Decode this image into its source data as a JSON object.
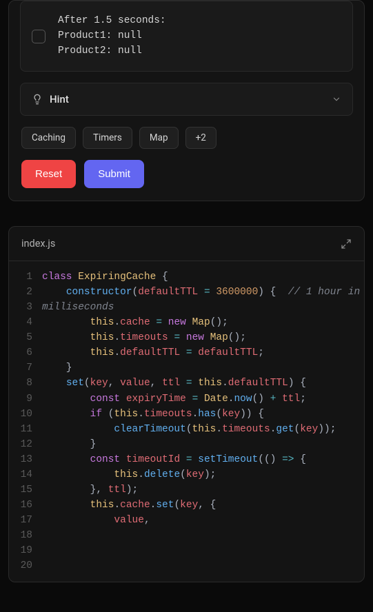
{
  "output": {
    "line1": "After 1.5 seconds:",
    "line2": "Product1: null",
    "line3": "Product2: null"
  },
  "hint": {
    "label": "Hint"
  },
  "tags": [
    "Caching",
    "Timers",
    "Map",
    "+2"
  ],
  "buttons": {
    "reset": "Reset",
    "submit": "Submit"
  },
  "editor": {
    "filename": "index.js"
  },
  "code": {
    "lines": [
      {
        "n": "1",
        "tokens": [
          [
            "kw",
            "class "
          ],
          [
            "cls",
            "ExpiringCache"
          ],
          [
            "pn",
            " {"
          ]
        ]
      },
      {
        "n": "2",
        "tokens": [
          [
            "pn",
            "    "
          ],
          [
            "fn",
            "constructor"
          ],
          [
            "pn",
            "("
          ],
          [
            "param",
            "defaultTTL"
          ],
          [
            "pn",
            " "
          ],
          [
            "op",
            "="
          ],
          [
            "pn",
            " "
          ],
          [
            "num",
            "3600000"
          ],
          [
            "pn",
            ") {  "
          ],
          [
            "cmt",
            "// 1 hour in milliseconds"
          ]
        ]
      },
      {
        "n": "3",
        "tokens": [
          [
            "pn",
            "        "
          ],
          [
            "this",
            "this"
          ],
          [
            "pn",
            "."
          ],
          [
            "prop",
            "cache"
          ],
          [
            "pn",
            " "
          ],
          [
            "op",
            "="
          ],
          [
            "pn",
            " "
          ],
          [
            "new",
            "new "
          ],
          [
            "cls",
            "Map"
          ],
          [
            "pn",
            "();"
          ]
        ]
      },
      {
        "n": "4",
        "tokens": [
          [
            "pn",
            "        "
          ],
          [
            "this",
            "this"
          ],
          [
            "pn",
            "."
          ],
          [
            "prop",
            "timeouts"
          ],
          [
            "pn",
            " "
          ],
          [
            "op",
            "="
          ],
          [
            "pn",
            " "
          ],
          [
            "new",
            "new "
          ],
          [
            "cls",
            "Map"
          ],
          [
            "pn",
            "();"
          ]
        ]
      },
      {
        "n": "5",
        "tokens": [
          [
            "pn",
            "        "
          ],
          [
            "this",
            "this"
          ],
          [
            "pn",
            "."
          ],
          [
            "prop",
            "defaultTTL"
          ],
          [
            "pn",
            " "
          ],
          [
            "op",
            "="
          ],
          [
            "pn",
            " "
          ],
          [
            "param",
            "defaultTTL"
          ],
          [
            "pn",
            ";"
          ]
        ]
      },
      {
        "n": "6",
        "tokens": [
          [
            "pn",
            "    }"
          ]
        ]
      },
      {
        "n": "7",
        "tokens": [
          [
            "pn",
            ""
          ]
        ]
      },
      {
        "n": "8",
        "tokens": [
          [
            "pn",
            "    "
          ],
          [
            "fn",
            "set"
          ],
          [
            "pn",
            "("
          ],
          [
            "param",
            "key"
          ],
          [
            "pn",
            ", "
          ],
          [
            "param",
            "value"
          ],
          [
            "pn",
            ", "
          ],
          [
            "param",
            "ttl"
          ],
          [
            "pn",
            " "
          ],
          [
            "op",
            "="
          ],
          [
            "pn",
            " "
          ],
          [
            "this",
            "this"
          ],
          [
            "pn",
            "."
          ],
          [
            "prop",
            "defaultTTL"
          ],
          [
            "pn",
            ") {"
          ]
        ]
      },
      {
        "n": "9",
        "tokens": [
          [
            "pn",
            "        "
          ],
          [
            "kw",
            "const "
          ],
          [
            "prop",
            "expiryTime"
          ],
          [
            "pn",
            " "
          ],
          [
            "op",
            "="
          ],
          [
            "pn",
            " "
          ],
          [
            "cls",
            "Date"
          ],
          [
            "pn",
            "."
          ],
          [
            "fn",
            "now"
          ],
          [
            "pn",
            "() "
          ],
          [
            "op",
            "+"
          ],
          [
            "pn",
            " "
          ],
          [
            "param",
            "ttl"
          ],
          [
            "pn",
            ";"
          ]
        ]
      },
      {
        "n": "10",
        "tokens": [
          [
            "pn",
            ""
          ]
        ]
      },
      {
        "n": "11",
        "tokens": [
          [
            "pn",
            "        "
          ],
          [
            "kw",
            "if"
          ],
          [
            "pn",
            " ("
          ],
          [
            "this",
            "this"
          ],
          [
            "pn",
            "."
          ],
          [
            "prop",
            "timeouts"
          ],
          [
            "pn",
            "."
          ],
          [
            "fn",
            "has"
          ],
          [
            "pn",
            "("
          ],
          [
            "param",
            "key"
          ],
          [
            "pn",
            ")) {"
          ]
        ]
      },
      {
        "n": "12",
        "tokens": [
          [
            "pn",
            "            "
          ],
          [
            "fn",
            "clearTimeout"
          ],
          [
            "pn",
            "("
          ],
          [
            "this",
            "this"
          ],
          [
            "pn",
            "."
          ],
          [
            "prop",
            "timeouts"
          ],
          [
            "pn",
            "."
          ],
          [
            "fn",
            "get"
          ],
          [
            "pn",
            "("
          ],
          [
            "param",
            "key"
          ],
          [
            "pn",
            "));"
          ]
        ]
      },
      {
        "n": "13",
        "tokens": [
          [
            "pn",
            "        }"
          ]
        ]
      },
      {
        "n": "14",
        "tokens": [
          [
            "pn",
            ""
          ]
        ]
      },
      {
        "n": "15",
        "tokens": [
          [
            "pn",
            "        "
          ],
          [
            "kw",
            "const "
          ],
          [
            "prop",
            "timeoutId"
          ],
          [
            "pn",
            " "
          ],
          [
            "op",
            "="
          ],
          [
            "pn",
            " "
          ],
          [
            "fn",
            "setTimeout"
          ],
          [
            "pn",
            "(() "
          ],
          [
            "op",
            "=>"
          ],
          [
            "pn",
            " {"
          ]
        ]
      },
      {
        "n": "16",
        "tokens": [
          [
            "pn",
            "            "
          ],
          [
            "this",
            "this"
          ],
          [
            "pn",
            "."
          ],
          [
            "fn",
            "delete"
          ],
          [
            "pn",
            "("
          ],
          [
            "param",
            "key"
          ],
          [
            "pn",
            ");"
          ]
        ]
      },
      {
        "n": "17",
        "tokens": [
          [
            "pn",
            "        }, "
          ],
          [
            "param",
            "ttl"
          ],
          [
            "pn",
            ");"
          ]
        ]
      },
      {
        "n": "18",
        "tokens": [
          [
            "pn",
            ""
          ]
        ]
      },
      {
        "n": "19",
        "tokens": [
          [
            "pn",
            "        "
          ],
          [
            "this",
            "this"
          ],
          [
            "pn",
            "."
          ],
          [
            "prop",
            "cache"
          ],
          [
            "pn",
            "."
          ],
          [
            "fn",
            "set"
          ],
          [
            "pn",
            "("
          ],
          [
            "param",
            "key"
          ],
          [
            "pn",
            ", {"
          ]
        ]
      },
      {
        "n": "20",
        "tokens": [
          [
            "pn",
            "            "
          ],
          [
            "prop",
            "value"
          ],
          [
            "pn",
            ","
          ]
        ]
      }
    ]
  }
}
